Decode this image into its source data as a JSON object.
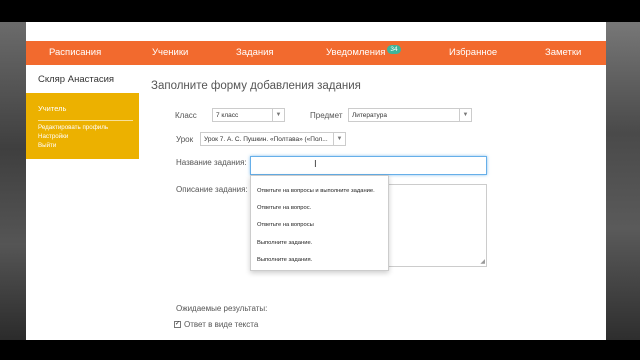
{
  "nav": {
    "schedule": "Расписания",
    "students": "Ученики",
    "tasks": "Задания",
    "notifications": "Уведомления",
    "notifications_count": "34",
    "favorites": "Избранное",
    "notes": "Заметки"
  },
  "user": {
    "name": "Скляр Анастасия",
    "role": "Учитель",
    "menu": [
      "Редактировать профиль",
      "Настройки",
      "Выйти"
    ]
  },
  "form": {
    "title": "Заполните форму добавления задания",
    "class_label": "Класс",
    "class_value": "7 класс",
    "subject_label": "Предмет",
    "subject_value": "Литература",
    "lesson_label": "Урок",
    "lesson_value": "Урок 7. А. С. Пушкин. «Полтава» («Пол...",
    "task_name_label": "Название задания:",
    "task_name_value": "",
    "description_label": "Описание задания:",
    "expected_results_label": "Ожидаемые результаты:",
    "text_answer_label": "Ответ в виде текста",
    "text_answer_checked": true
  },
  "suggestions": [
    "Ответьте на вопросы и выполните задание.",
    "Ответьте на вопрос.",
    "Ответьте на вопросы",
    "Выполните задание.",
    "Выполните задания."
  ],
  "colors": {
    "nav": "#f26a2e",
    "user_panel": "#ecb100",
    "badge": "#3fb49a"
  }
}
